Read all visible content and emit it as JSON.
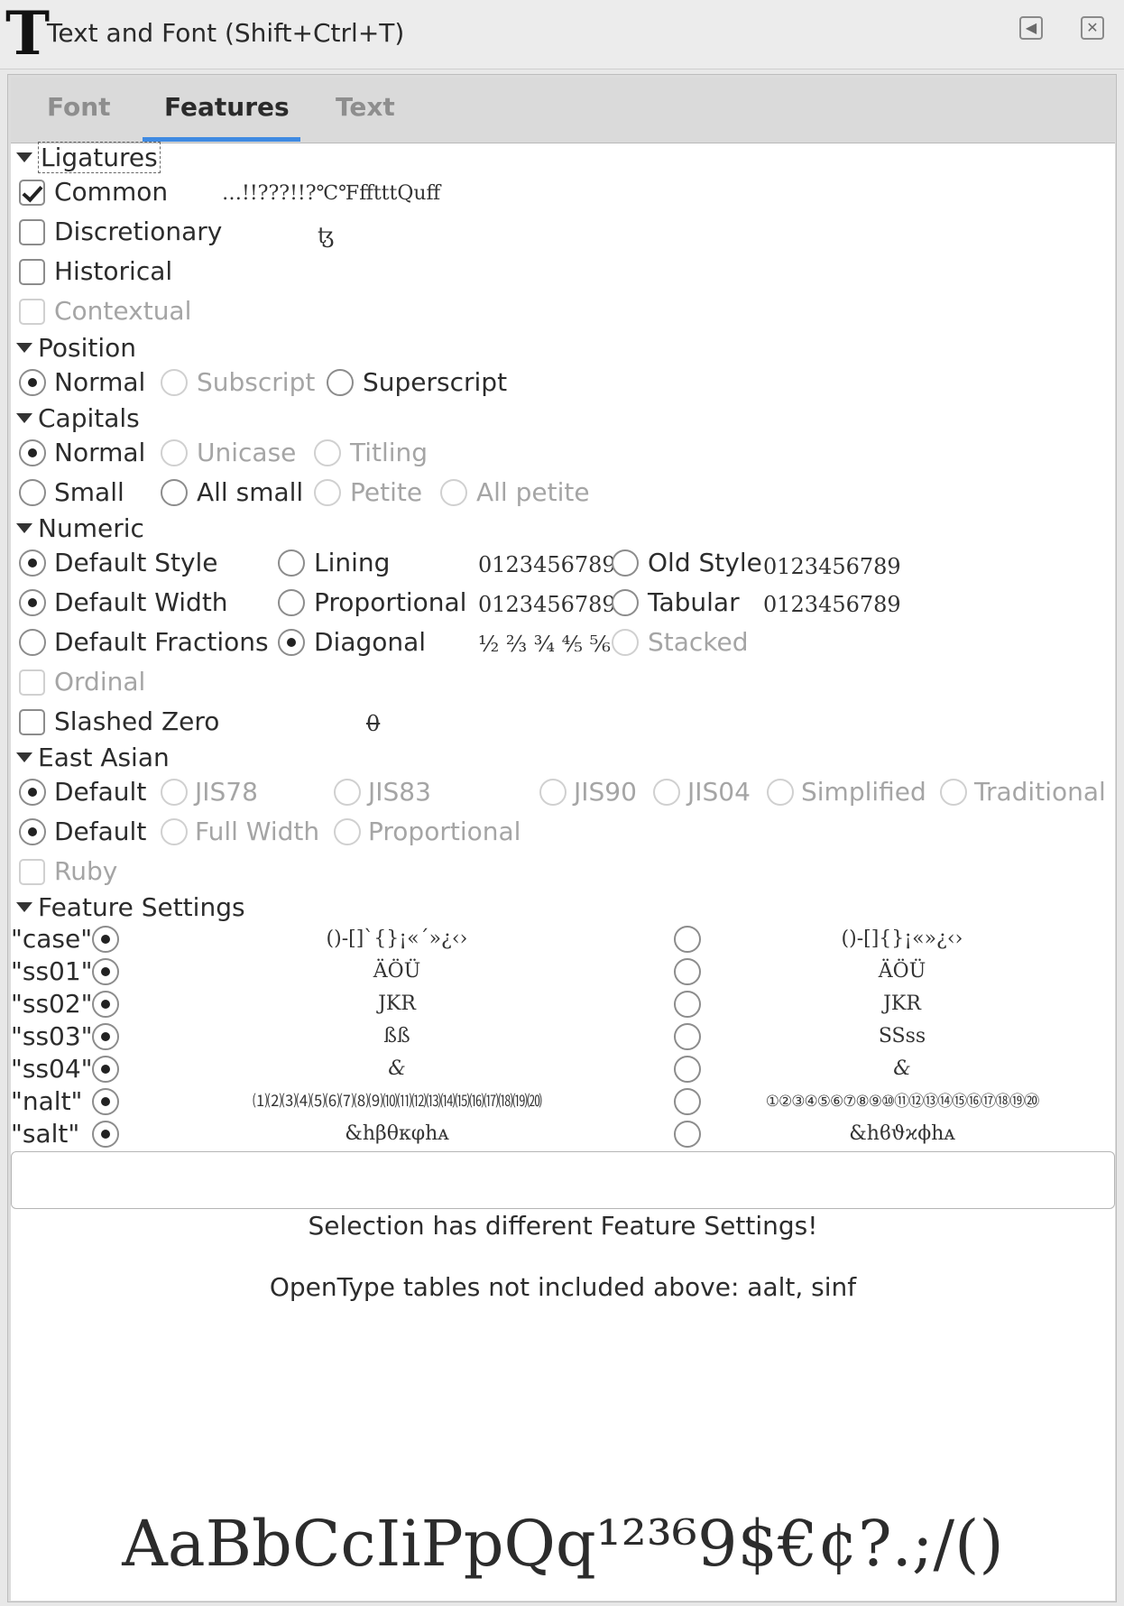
{
  "window": {
    "title_icon": "T",
    "title": "Text and Font (Shift+Ctrl+T)"
  },
  "tabs": [
    "Font",
    "Features",
    "Text"
  ],
  "ligatures": {
    "header": "Ligatures",
    "common": "Common",
    "common_sample": "…!!???!!?℃℉fftttQuff",
    "discretionary": "Discretionary",
    "discretionary_sample": "ꜩ",
    "historical": "Historical",
    "contextual": "Contextual"
  },
  "position": {
    "header": "Position",
    "normal": "Normal",
    "subscript": "Subscript",
    "superscript": "Superscript"
  },
  "capitals": {
    "header": "Capitals",
    "normal": "Normal",
    "unicase": "Unicase",
    "titling": "Titling",
    "small": "Small",
    "all_small": "All small",
    "petite": "Petite",
    "all_petite": "All petite"
  },
  "numeric": {
    "header": "Numeric",
    "default_style": "Default Style",
    "lining": "Lining",
    "lining_sample": "0123456789",
    "old_style": "Old Style",
    "old_style_sample": "0123456789",
    "default_width": "Default Width",
    "proportional": "Proportional",
    "proportional_sample": "0123456789",
    "tabular": "Tabular",
    "tabular_sample": "0123456789",
    "default_fractions": "Default Fractions",
    "diagonal": "Diagonal",
    "diagonal_sample": "½ ⅔ ¾ ⅘ ⅚",
    "stacked": "Stacked",
    "ordinal": "Ordinal",
    "slashed_zero": "Slashed Zero",
    "slashed_zero_sample": "0"
  },
  "east_asian": {
    "header": "East Asian",
    "default1": "Default",
    "jis78": "JIS78",
    "jis83": "JIS83",
    "jis90": "JIS90",
    "jis04": "JIS04",
    "simplified": "Simplified",
    "traditional": "Traditional",
    "default2": "Default",
    "full_width": "Full Width",
    "proportional": "Proportional",
    "ruby": "Ruby"
  },
  "feature_settings": {
    "header": "Feature Settings",
    "rows": [
      {
        "tag": "\"case\"",
        "on_sample": "()-[]`{}¡«´»¿‹›",
        "off_sample": "()-[]{}¡«»¿‹›"
      },
      {
        "tag": "\"ss01\"",
        "on_sample": "ÄÖÜ",
        "off_sample": "ÄÖÜ"
      },
      {
        "tag": "\"ss02\"",
        "on_sample": "JKR",
        "off_sample": "JKR"
      },
      {
        "tag": "\"ss03\"",
        "on_sample": "ßß",
        "off_sample": "SSss"
      },
      {
        "tag": "\"ss04\"",
        "on_sample": "&",
        "off_sample": "&"
      },
      {
        "tag": "\"nalt\"",
        "on_sample": "⑴⑵⑶⑷⑸⑹⑺⑻⑼⑽⑾⑿⒀⒁⒂⒃⒄⒅⒆⒇",
        "off_sample": "①②③④⑤⑥⑦⑧⑨⑩⑪⑫⑬⑭⑮⑯⑰⑱⑲⑳"
      },
      {
        "tag": "\"salt\"",
        "on_sample": "&hβθκφhᴀ",
        "off_sample": "&hϐϑϰϕhᴀ"
      }
    ]
  },
  "messages": {
    "different": "Selection has different Feature Settings!",
    "tables": "OpenType tables not included above: aalt, sinf"
  },
  "preview_text": "AaBbCcIiPpQq¹²³⁶9$€¢?.;/()"
}
